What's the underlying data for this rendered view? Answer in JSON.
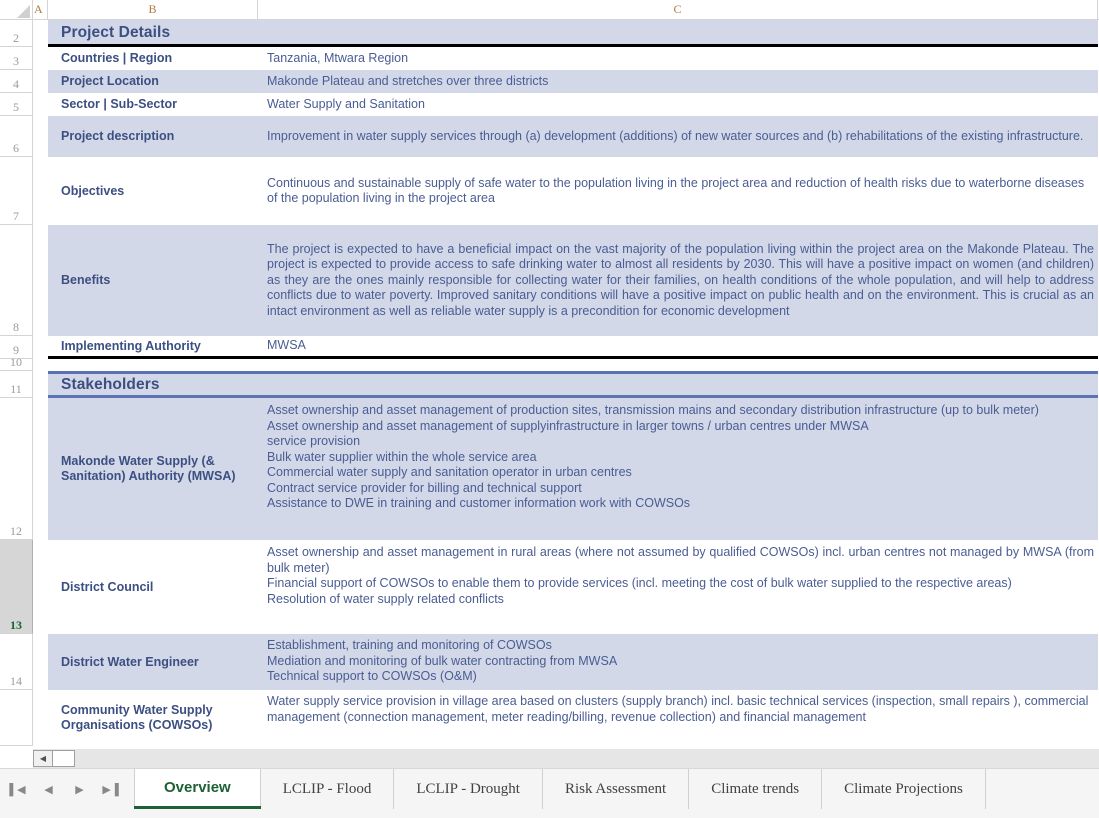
{
  "columns": [
    {
      "label": "A"
    },
    {
      "label": "B"
    },
    {
      "label": "C"
    }
  ],
  "rows": {
    "r2": "2",
    "r3": "3",
    "r4": "4",
    "r5": "5",
    "r6": "6",
    "r7": "7",
    "r8": "8",
    "r9": "9",
    "r10": "10",
    "r11": "11",
    "r12": "12",
    "r13": "13",
    "r14": "14"
  },
  "selected_row": "13",
  "sections": {
    "project_details": {
      "title": "Project Details",
      "fields": [
        {
          "label": "Countries | Region",
          "value": "Tanzania, Mtwara Region"
        },
        {
          "label": "Project Location",
          "value": "Makonde Plateau and stretches over three districts"
        },
        {
          "label": "Sector | Sub-Sector",
          "value": "Water Supply and Sanitation"
        },
        {
          "label": "Project description",
          "value": "Improvement in water supply services through (a) development (additions) of new water sources and (b) rehabilitations of the existing infrastructure."
        },
        {
          "label": "Objectives",
          "value": "Continuous and sustainable supply of safe water to the population living in the project area and reduction of health risks due to waterborne diseases of the population living in the project area"
        },
        {
          "label": "Benefits",
          "value": "The project is expected to have a beneficial impact on the vast majority of the population living within the project area on the Makonde Plateau. The project is expected to provide access to safe drinking water to almost all residents by 2030. This will have a positive impact on women (and children) as they are the ones mainly responsible for collecting water for their families, on health conditions of the whole population, and will help to address conflicts due to water poverty. Improved sanitary conditions will have a positive impact on public health and on the environment. This is crucial as an intact environment as well as reliable water supply is a precondition for economic development"
        },
        {
          "label": "Implementing Authority",
          "value": "MWSA"
        }
      ]
    },
    "stakeholders": {
      "title": "Stakeholders",
      "entries": [
        {
          "label": "Makonde Water Supply (& Sanitation) Authority (MWSA)",
          "lines": [
            "Asset ownership and asset management of production sites, transmission mains and secondary distribution infrastructure (up to bulk meter)",
            "Asset ownership and asset management of supplyinfrastructure in larger towns / urban centres under MWSA",
            "service provision",
            "Bulk water supplier within the whole service area",
            "Commercial water supply and sanitation operator in urban centres",
            "Contract service provider for billing and technical support",
            "Assistance to DWE in training and customer information work with COWSOs"
          ]
        },
        {
          "label": "District Council",
          "lines": [
            "Asset ownership and asset management in rural areas (where not assumed by qualified COWSOs) incl. urban centres not managed by MWSA (from bulk meter)",
            "Financial support of COWSOs to enable them to provide services (incl. meeting the cost of bulk water supplied to the respective areas)",
            "Resolution of water supply related conflicts"
          ]
        },
        {
          "label": "District Water Engineer",
          "lines": [
            "Establishment, training and monitoring of COWSOs",
            "Mediation and monitoring of bulk water contracting from MWSA",
            "Technical support to COWSOs (O&M)"
          ]
        },
        {
          "label": "Community Water Supply Organisations (COWSOs)",
          "lines": [
            "Water supply service provision in village area based on clusters (supply branch) incl. basic technical services (inspection, small repairs ), commercial management (connection management, meter reading/billing, revenue collection) and financial management"
          ]
        }
      ]
    }
  },
  "sheet_tabs": [
    {
      "label": "Overview",
      "active": true
    },
    {
      "label": "LCLIP - Flood",
      "active": false
    },
    {
      "label": "LCLIP - Drought",
      "active": false
    },
    {
      "label": "Risk Assessment",
      "active": false
    },
    {
      "label": "Climate trends",
      "active": false
    },
    {
      "label": "Climate Projections",
      "active": false
    }
  ],
  "nav_buttons": [
    {
      "name": "first-sheet-button",
      "glyph": "▌◀"
    },
    {
      "name": "previous-sheet-button",
      "glyph": "◀"
    },
    {
      "name": "next-sheet-button",
      "glyph": "▶"
    },
    {
      "name": "last-sheet-button",
      "glyph": "▶▐"
    }
  ],
  "scrollbar": {
    "left_arrow": "◀"
  },
  "colors": {
    "band": "#d2d8e8",
    "header_text": "#3c4f82",
    "body_text": "#4a5d93",
    "active_tab": "#1d6135"
  }
}
